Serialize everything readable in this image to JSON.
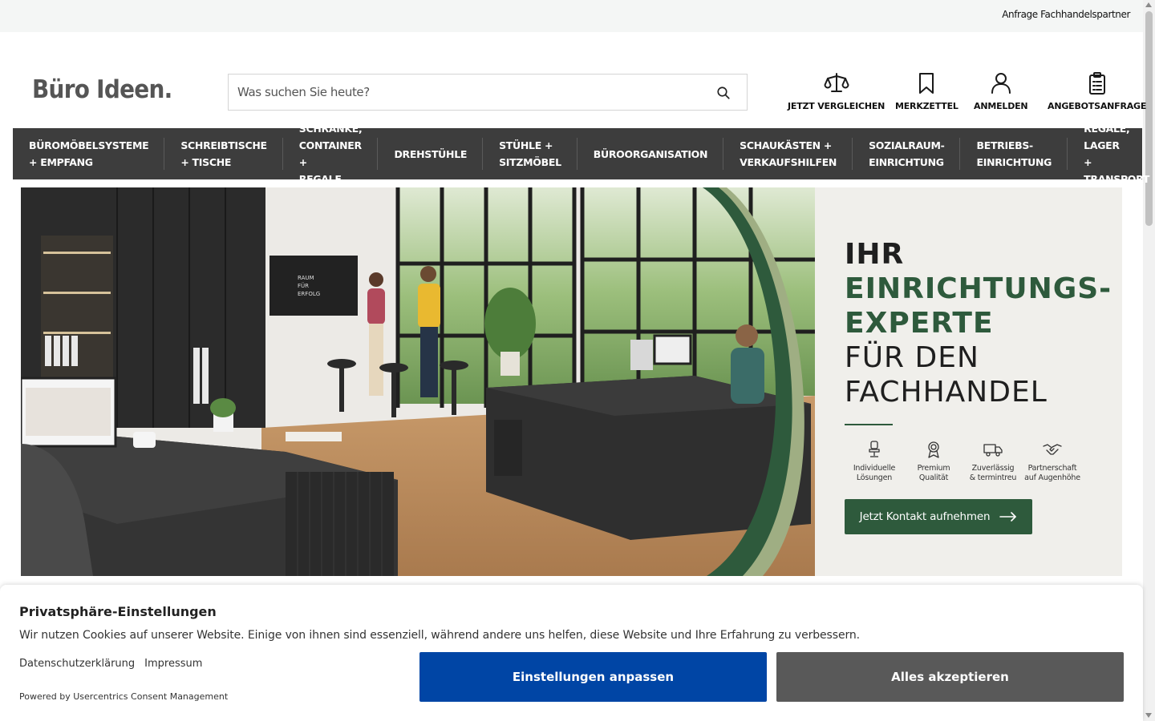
{
  "topbar": {
    "dealer_link": "Anfrage Fachhandelspartner"
  },
  "header": {
    "logo": "Büro Ideen.",
    "search_placeholder": "Was suchen Sie heute?",
    "actions": [
      {
        "label": "JETZT VERGLEICHEN",
        "icon": "scale-icon"
      },
      {
        "label": "MERKZETTEL",
        "icon": "bookmark-icon"
      },
      {
        "label": "ANMELDEN",
        "icon": "user-icon"
      },
      {
        "label": "ANGEBOTSANFRAGE",
        "icon": "clipboard-icon"
      }
    ]
  },
  "nav": {
    "items": [
      "BÜROMÖBELSYSTEME\n+ EMPFANG",
      "SCHREIBTISCHE\n+ TISCHE",
      "SCHRÄNKE,\nCONTAINER +\nREGALE",
      "DREHSTÜHLE",
      "STÜHLE +\nSITZMÖBEL",
      "BÜROORGANISATION",
      "SCHAUKÄSTEN +\nVERKAUFSHILFEN",
      "SOZIALRAUM-\nEINRICHTUNG",
      "BETRIEBS-\nEINRICHTUNG",
      "REGALE, LAGER\n+ TRANSPORT"
    ]
  },
  "hero": {
    "line1": "IHR",
    "line2": "EINRICHTUNGS-",
    "line3": "EXPERTE",
    "line4": "FÜR DEN",
    "line5": "FACHHANDEL",
    "screen_text": "RAUM FÜR ERFOLG",
    "features": [
      {
        "label": "Individuelle\nLösungen",
        "icon": "chair-icon"
      },
      {
        "label": "Premium\nQualität",
        "icon": "award-icon"
      },
      {
        "label": "Zuverlässig\n& termintreu",
        "icon": "truck-icon"
      },
      {
        "label": "Partnerschaft\nauf Augenhöhe",
        "icon": "handshake-icon"
      }
    ],
    "cta": "Jetzt Kontakt aufnehmen",
    "colors": {
      "accent": "#2e5a3c"
    }
  },
  "cookie": {
    "title": "Privatsphäre-Einstellungen",
    "text": "Wir nutzen Cookies auf unserer Website. Einige von ihnen sind essenziell, während andere uns helfen, diese Website und Ihre Erfahrung zu verbessern.",
    "privacy_link": "Datenschutzerklärung",
    "imprint_link": "Impressum",
    "powered": "Powered by Usercentrics Consent Management",
    "settings_button": "Einstellungen anpassen",
    "accept_button": "Alles akzeptieren",
    "colors": {
      "settings": "#0045a5",
      "accept": "#595959"
    }
  }
}
